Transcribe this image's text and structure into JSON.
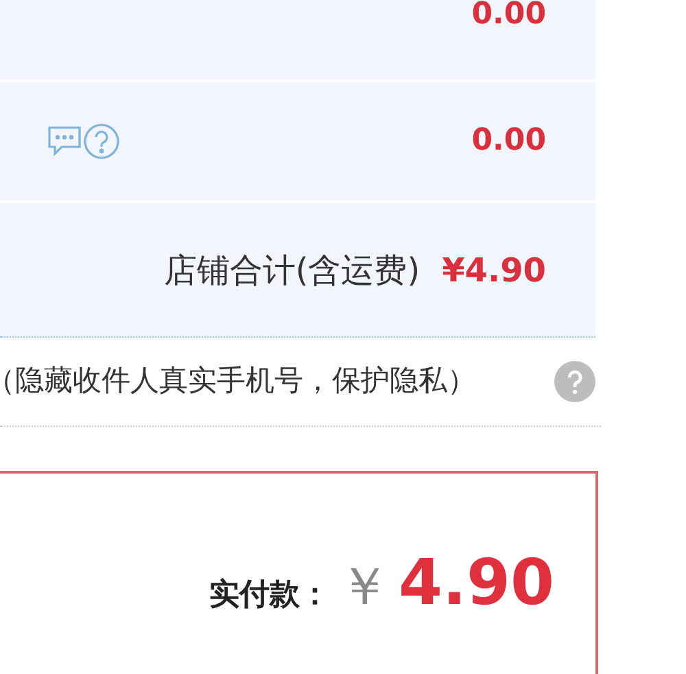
{
  "fee_rows": [
    {
      "kind": "plain",
      "amount": "0.00"
    },
    {
      "kind": "with_help",
      "amount": "0.00"
    }
  ],
  "shop_total": {
    "label": "店铺合计(含运费)",
    "amount": "¥4.90"
  },
  "privacy_option": {
    "label": "（隐藏收件人真实手机号，保护隐私）"
  },
  "payment": {
    "label": "实付款：",
    "currency": "￥",
    "amount": "4.90"
  }
}
